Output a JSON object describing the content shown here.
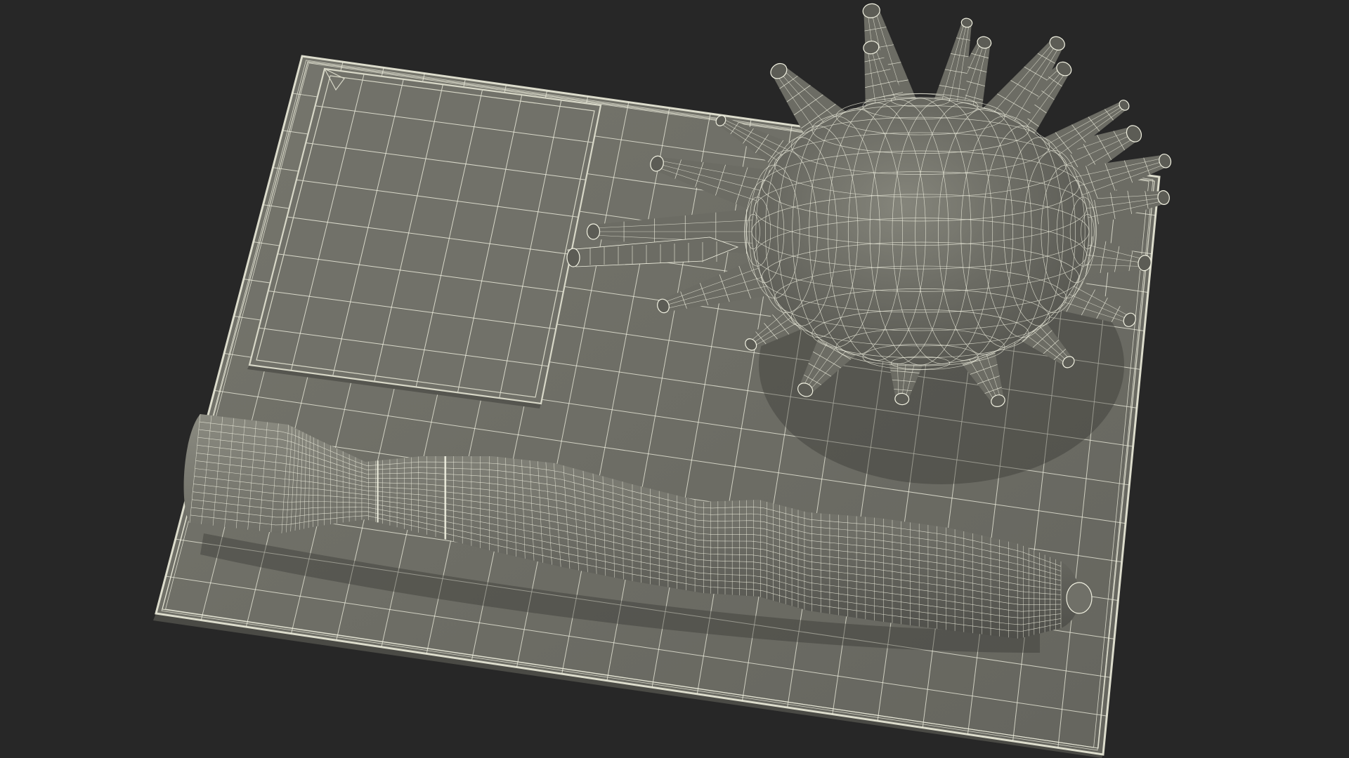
{
  "scene": {
    "background_color": "#272727",
    "surface_color": "#6f6f66",
    "surface_shade_color": "#5a5a53",
    "wire_color": "#f2f2e2",
    "edge_color": "#d8d8c8",
    "objects": [
      {
        "name": "base-plate",
        "kind": "rectangular plate"
      },
      {
        "name": "label-panel",
        "kind": "raised rectangular panel"
      },
      {
        "name": "neuron-cell-body",
        "kind": "spiky cell body with dendrites"
      },
      {
        "name": "axon",
        "kind": "elongated segmented tube"
      }
    ]
  }
}
